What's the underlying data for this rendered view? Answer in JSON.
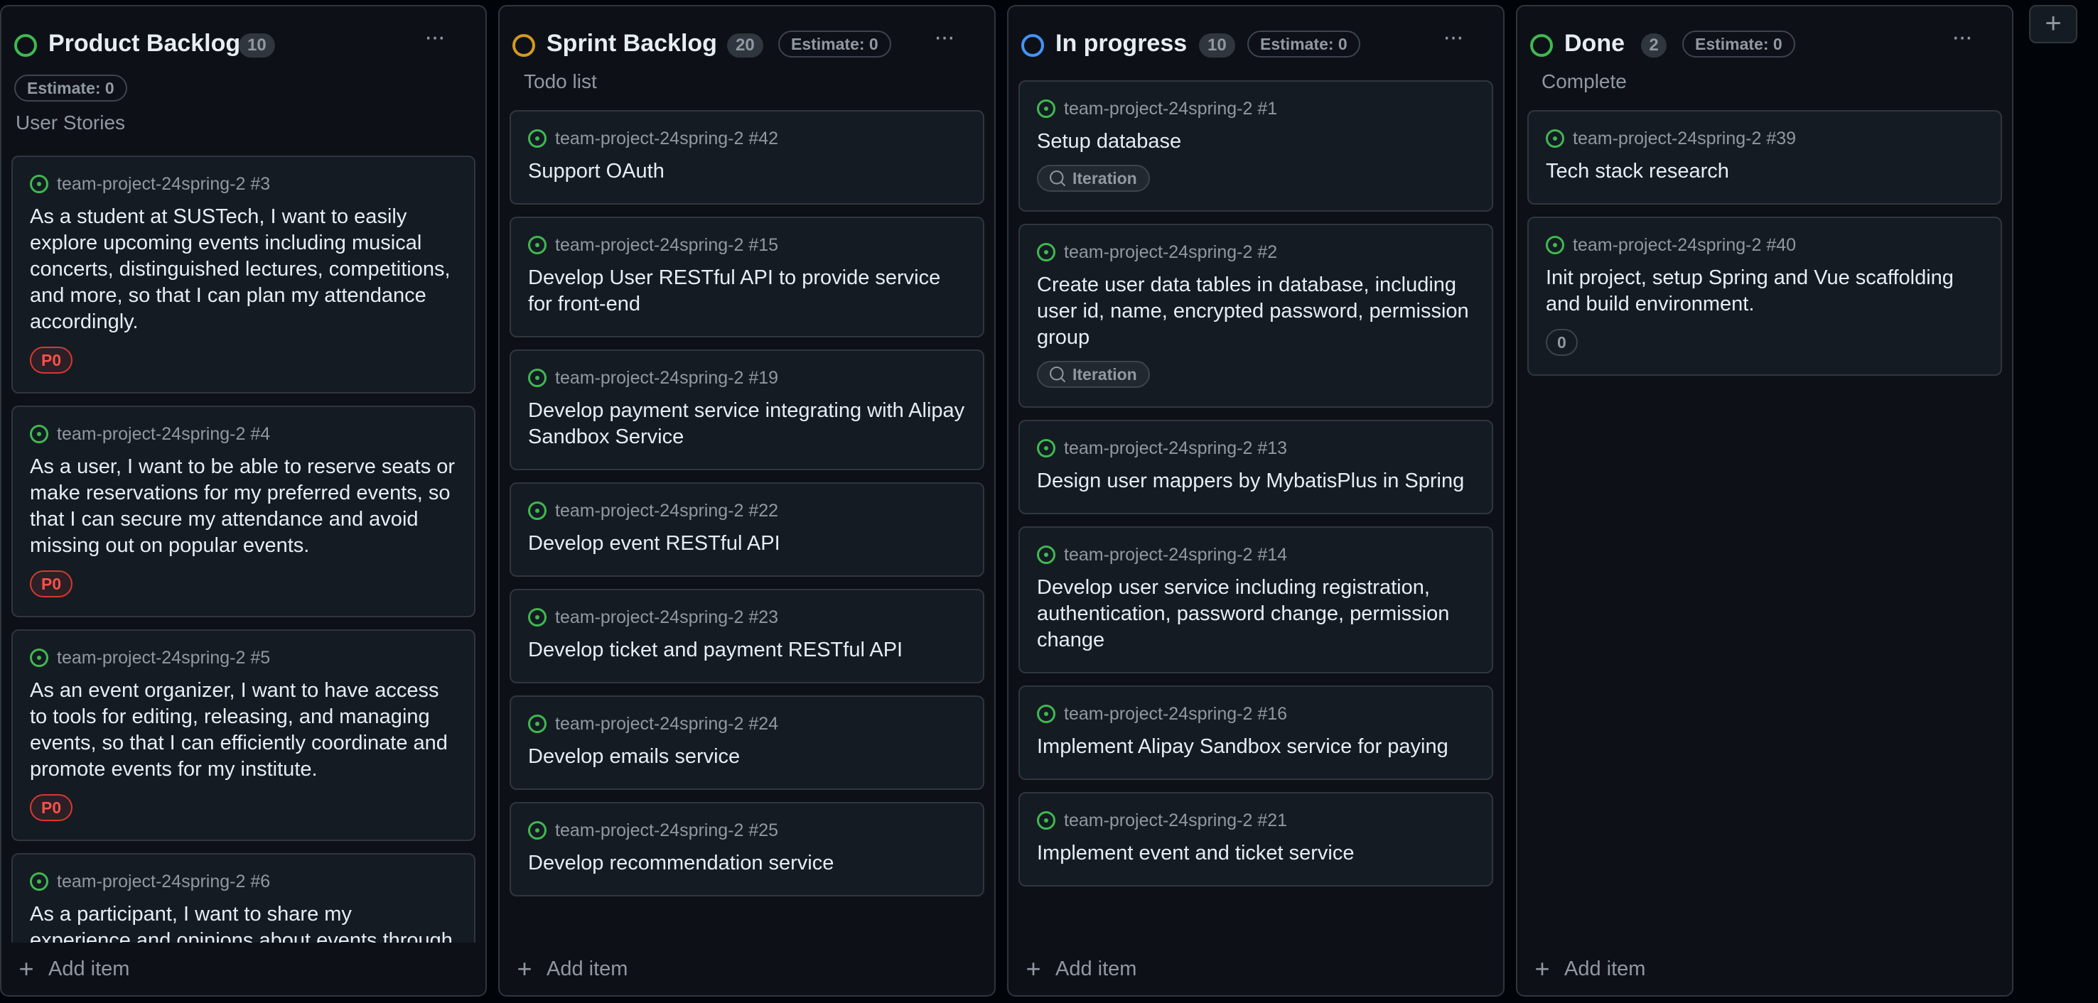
{
  "colors": {
    "green": "#3fb950",
    "orange": "#d29922",
    "blue": "#4493f8",
    "p0_red": "#f85149"
  },
  "columns": [
    {
      "title": "Product Backlog",
      "count": "10",
      "estimate": "Estimate: 0",
      "description": "User Stories",
      "status_color": "#3fb950",
      "add_item": "Add item",
      "cards": [
        {
          "ref": "team-project-24spring-2 #3",
          "title": "As a student at SUSTech, I want to easily explore upcoming events including musical concerts, distinguished lectures, competitions, and more, so that I can plan my attendance accordingly.",
          "label": "P0"
        },
        {
          "ref": "team-project-24spring-2 #4",
          "title": "As a user, I want to be able to reserve seats or make reservations for my preferred events, so that I can secure my attendance and avoid missing out on popular events.",
          "label": "P0"
        },
        {
          "ref": "team-project-24spring-2 #5",
          "title": "As an event organizer, I want to have access to tools for editing, releasing, and managing events, so that I can efficiently coordinate and promote events for my institute.",
          "label": "P0"
        },
        {
          "ref": "team-project-24spring-2 #6",
          "title": "As a participant, I want to share my experience and opinions about events through reviews, so"
        }
      ]
    },
    {
      "title": "Sprint Backlog",
      "count": "20",
      "estimate": "Estimate: 0",
      "description": "Todo list",
      "status_color": "#d29922",
      "add_item": "Add item",
      "cards": [
        {
          "ref": "team-project-24spring-2 #42",
          "title": "Support OAuth"
        },
        {
          "ref": "team-project-24spring-2 #15",
          "title": "Develop User RESTful API to provide service for front-end"
        },
        {
          "ref": "team-project-24spring-2 #19",
          "title": "Develop payment service integrating with Alipay Sandbox Service"
        },
        {
          "ref": "team-project-24spring-2 #22",
          "title": "Develop event RESTful API"
        },
        {
          "ref": "team-project-24spring-2 #23",
          "title": "Develop ticket and payment RESTful API"
        },
        {
          "ref": "team-project-24spring-2 #24",
          "title": "Develop emails service"
        },
        {
          "ref": "team-project-24spring-2 #25",
          "title": "Develop recommendation service"
        }
      ]
    },
    {
      "title": "In progress",
      "count": "10",
      "estimate": "Estimate: 0",
      "description": "",
      "status_color": "#4493f8",
      "add_item": "Add item",
      "cards": [
        {
          "ref": "team-project-24spring-2 #1",
          "title": "Setup database",
          "iteration": "Iteration"
        },
        {
          "ref": "team-project-24spring-2 #2",
          "title": "Create user data tables in database, including user id, name, encrypted password, permission group",
          "iteration": "Iteration"
        },
        {
          "ref": "team-project-24spring-2 #13",
          "title": "Design user mappers by MybatisPlus in Spring"
        },
        {
          "ref": "team-project-24spring-2 #14",
          "title": "Develop user service including registration, authentication, password change, permission change"
        },
        {
          "ref": "team-project-24spring-2 #16",
          "title": "Implement Alipay Sandbox service for paying"
        },
        {
          "ref": "team-project-24spring-2 #21",
          "title": "Implement event and ticket service"
        }
      ]
    },
    {
      "title": "Done",
      "count": "2",
      "estimate": "Estimate: 0",
      "description": "Complete",
      "status_color": "#3fb950",
      "add_item": "Add item",
      "cards": [
        {
          "ref": "team-project-24spring-2 #39",
          "title": "Tech stack research"
        },
        {
          "ref": "team-project-24spring-2 #40",
          "title": "Init project, setup Spring and Vue scaffolding and build environment.",
          "label_num": "0"
        }
      ]
    }
  ],
  "new_column_label": "+"
}
